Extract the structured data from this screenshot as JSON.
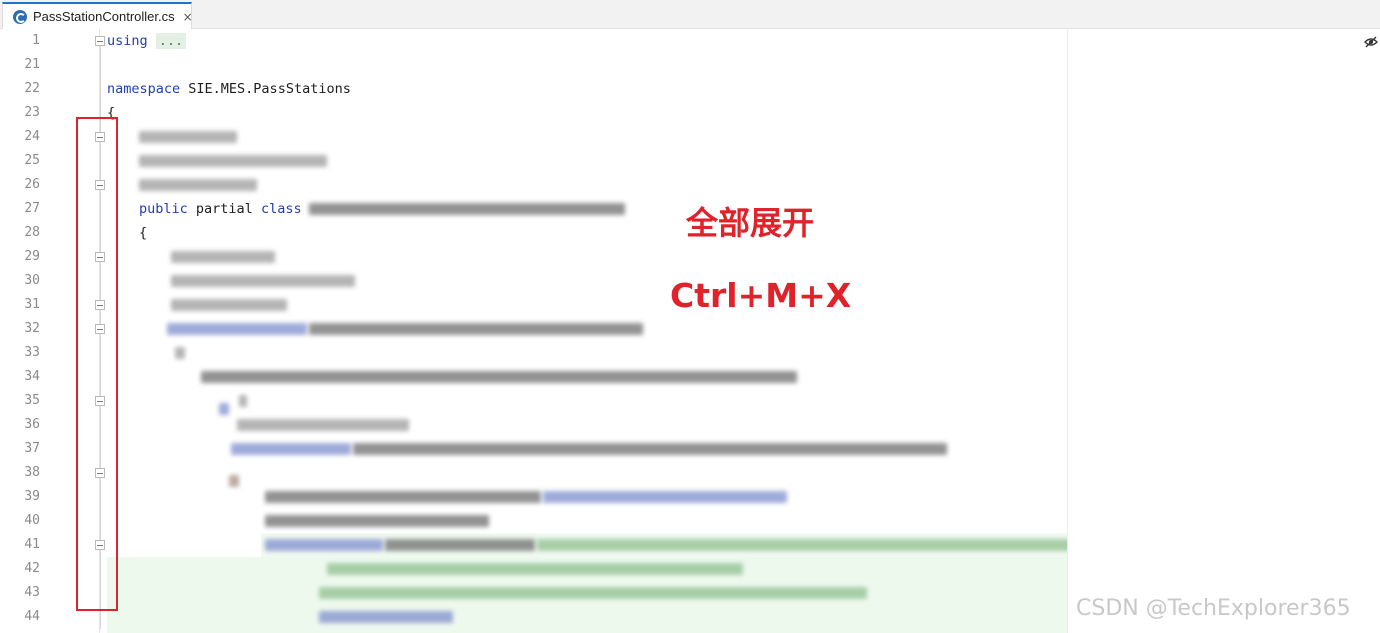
{
  "tab": {
    "icon": "csharp-file-icon",
    "label": "PassStationController.cs",
    "close_label": "×"
  },
  "editor": {
    "line_numbers": [
      "1",
      "21",
      "22",
      "23",
      "24",
      "25",
      "26",
      "27",
      "28",
      "29",
      "30",
      "31",
      "32",
      "33",
      "34",
      "35",
      "36",
      "37",
      "38",
      "39",
      "40",
      "41",
      "42",
      "43",
      "44"
    ],
    "lines": {
      "l1_kw": "using",
      "l1_collapsed": "...",
      "l22_kw": "namespace",
      "l22_text": " SIE.MES.PassStations",
      "l23_text": "{",
      "l27_kw1": "public",
      "l27_text": " partial ",
      "l27_kw2": "class",
      "l28_text": "{"
    }
  },
  "annotation": {
    "title": "全部展开",
    "shortcut": "Ctrl+M+X",
    "highlight_color": "#e0222a"
  },
  "watermark": "CSDN @TechExplorer365",
  "colors": {
    "keyword": "#1f3fb3",
    "tab_accent": "#1e74c9",
    "collapsed_bg": "#e4f0e4",
    "changed_line_bg": "#eef9ee"
  }
}
